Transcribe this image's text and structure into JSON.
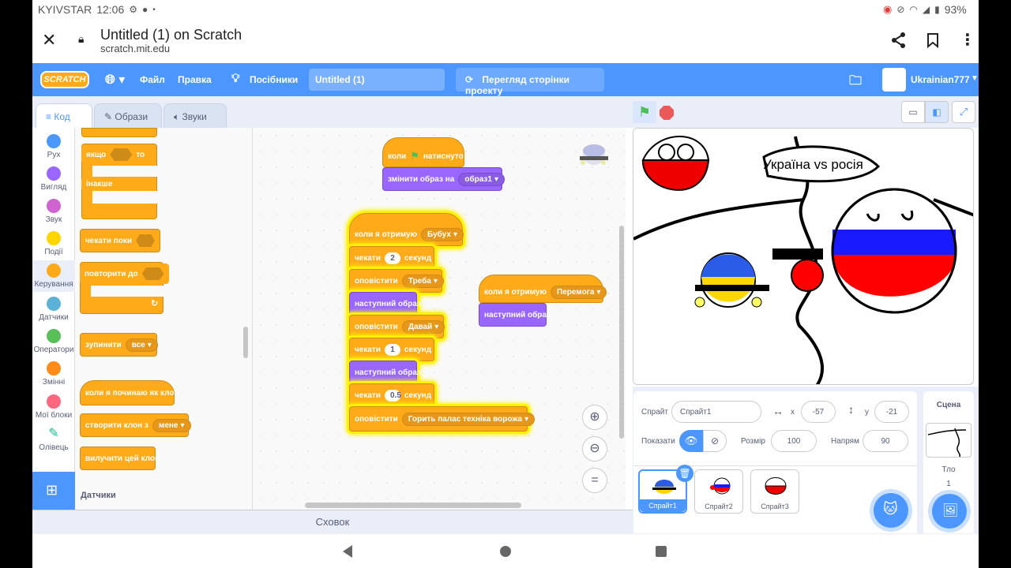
{
  "status": {
    "carrier": "KYIVSTAR",
    "time": "12:06",
    "battery": "93%"
  },
  "browser": {
    "page_title": "Untitled (1) on Scratch",
    "url": "scratch.mit.edu"
  },
  "menu": {
    "logo": "SCRATCH",
    "file": "Файл",
    "edit": "Правка",
    "tutorials": "Посібники",
    "project_title": "Untitled (1)",
    "see_project_page": "Перегляд сторінки проекту",
    "username": "Ukrainian777"
  },
  "tabs": {
    "code": "Код",
    "costumes": "Образи",
    "sounds": "Звуки"
  },
  "categories": [
    {
      "label": "Рух",
      "color": "#4c97ff"
    },
    {
      "label": "Вигляд",
      "color": "#9966ff"
    },
    {
      "label": "Звук",
      "color": "#cf63cf"
    },
    {
      "label": "Події",
      "color": "#ffd500"
    },
    {
      "label": "Керування",
      "color": "#ffab19"
    },
    {
      "label": "Датчики",
      "color": "#5cb1d6"
    },
    {
      "label": "Оператори",
      "color": "#59c059"
    },
    {
      "label": "Змінні",
      "color": "#ff8c1a"
    },
    {
      "label": "Мої блоки",
      "color": "#ff6680"
    },
    {
      "label": "Олівець",
      "color": "#0fbd8c"
    }
  ],
  "palette": {
    "if_label": "якщо",
    "then_label": "то",
    "else_label": "інакше",
    "wait_until": "чекати поки",
    "repeat_until": "повторити до",
    "stop": "зупинити",
    "stop_option": "все",
    "when_clone": "коли я починаю як клон",
    "create_clone": "створити клон з",
    "create_clone_option": "мене",
    "delete_clone": "вилучити цей клон",
    "section_sensing": "Датчики"
  },
  "script1": {
    "hat": "коли",
    "hat_suffix": "натиснуто",
    "switch_costume": "змінити образ на",
    "costume_option": "образ1"
  },
  "script2": {
    "when_receive": "коли я отримую",
    "receive_option": "Бубух",
    "wait": "чекати",
    "seconds": "секунд",
    "wait1_value": "2",
    "broadcast": "оповістити",
    "broadcast1_option": "Треба",
    "next_costume": "наступний образ",
    "broadcast2_option": "Давай",
    "wait2_value": "1",
    "wait3_value": "0.5",
    "broadcast3_option": "Горить палас техніка ворожа"
  },
  "script3": {
    "when_receive": "коли я отримую",
    "receive_option": "Перемога",
    "next_costume": "наступний образ"
  },
  "backpack": "Сховок",
  "stage": {
    "caption": "Україна vs росія"
  },
  "sprite_info": {
    "sprite_label": "Спрайт",
    "sprite_name": "Спрайт1",
    "x_label": "x",
    "x_value": "-57",
    "y_label": "y",
    "y_value": "-21",
    "show_label": "Показати",
    "size_label": "Розмір",
    "size_value": "100",
    "direction_label": "Напрям",
    "direction_value": "90"
  },
  "sprites": [
    "Спрайт1",
    "Спрайт2",
    "Спрайт3"
  ],
  "scene": {
    "title": "Сцена",
    "backdrops_label": "Тло",
    "backdrops_count": "1"
  }
}
